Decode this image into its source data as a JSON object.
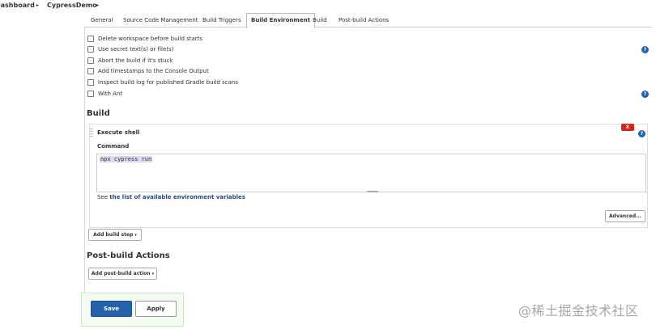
{
  "breadcrumb": {
    "dashboard": "Dashboard",
    "project": "CypressDemo",
    "separator": "▸"
  },
  "tabs": [
    {
      "label": "General"
    },
    {
      "label": "Source Code Management"
    },
    {
      "label": "Build Triggers"
    },
    {
      "label": "Build Environment",
      "active": true
    },
    {
      "label": "Build"
    },
    {
      "label": "Post-build Actions"
    }
  ],
  "build_environment": {
    "options": [
      {
        "label": "Delete workspace before build starts",
        "checked": false
      },
      {
        "label": "Use secret text(s) or file(s)",
        "checked": false
      },
      {
        "label": "Abort the build if it's stuck",
        "checked": false
      },
      {
        "label": "Add timestamps to the Console Output",
        "checked": false
      },
      {
        "label": "Inspect build log for published Gradle build scans",
        "checked": false
      },
      {
        "label": "With Ant",
        "checked": false
      }
    ],
    "help_glyph": "?"
  },
  "build": {
    "title": "Build",
    "step": {
      "title": "Execute shell",
      "delete_label": "X",
      "command_label": "Command",
      "command_value": "npx cypress run",
      "see_prefix": "See ",
      "see_link": "the list of available environment variables",
      "advanced_label": "Advanced..."
    },
    "add_step_label": "Add build step",
    "dropdown_glyph": "▾"
  },
  "post_build": {
    "title": "Post-build Actions",
    "add_action_label": "Add post-build action"
  },
  "actions": {
    "save": "Save",
    "apply": "Apply"
  },
  "watermark": "@稀土掘金技术社区",
  "colors": {
    "primary": "#2562ac",
    "danger": "#d9221b",
    "link": "#204a87",
    "help": "#2062b5"
  }
}
